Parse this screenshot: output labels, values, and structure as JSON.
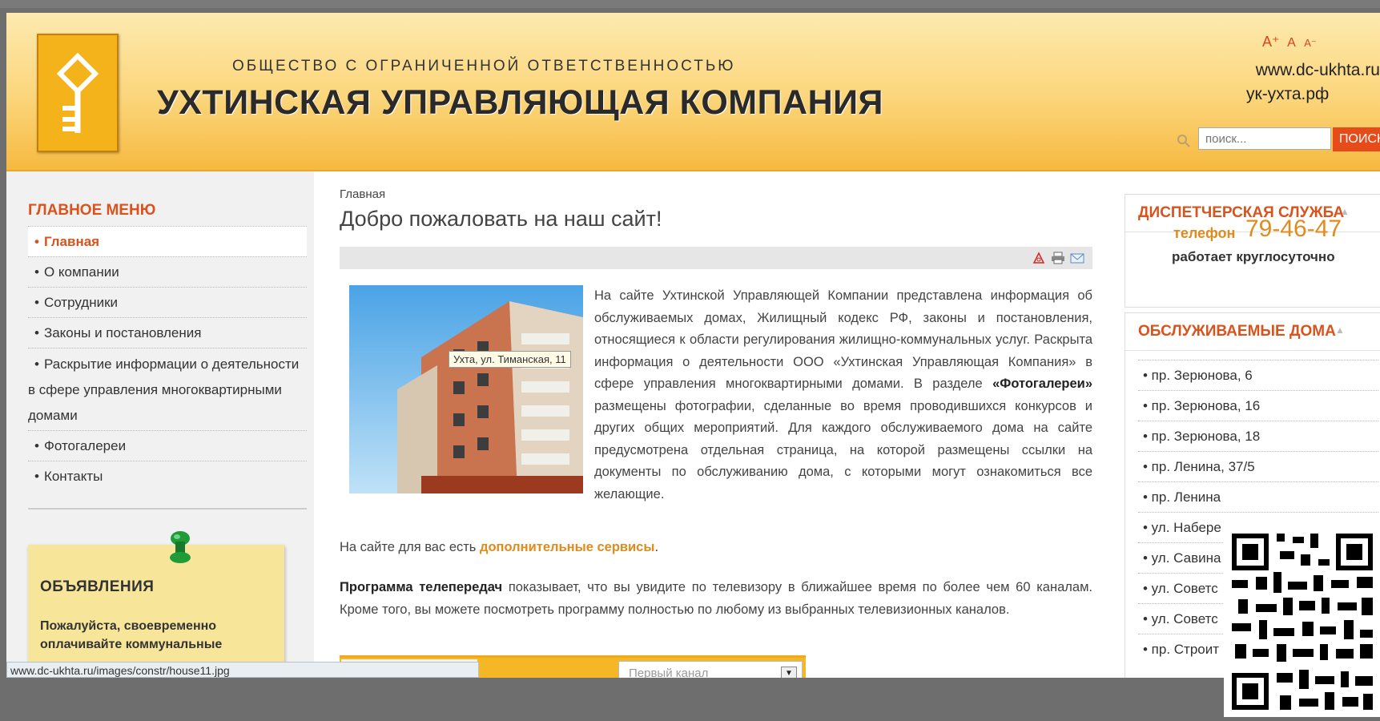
{
  "header": {
    "company_sub": "ОБЩЕСТВО С ОГРАНИЧЕННОЙ ОТВЕТСТВЕННОСТЬЮ",
    "company_name": "УХТИНСКАЯ УПРАВЛЯЮЩАЯ КОМПАНИЯ",
    "font_controls": [
      "A⁺",
      "A",
      "A⁻"
    ],
    "site_url": "www.dc-ukhta.ru",
    "site_url_rf": "ук-ухта.рф",
    "search_placeholder": "поиск...",
    "search_button": "ПОИСК"
  },
  "sidebar": {
    "menu_title": "ГЛАВНОЕ МЕНЮ",
    "items": [
      {
        "label": "Главная",
        "active": true
      },
      {
        "label": "О компании"
      },
      {
        "label": "Сотрудники"
      },
      {
        "label": "Законы и постановления"
      },
      {
        "label": "Раскрытие информации о деятельности в сфере управления многоквартирными домами"
      },
      {
        "label": "Фотогалереи"
      },
      {
        "label": "Контакты"
      }
    ],
    "notice_title": "ОБЪЯВЛЕНИЯ",
    "notice_text": "Пожалуйста, своевременно оплачивайте коммунальные"
  },
  "main": {
    "breadcrumb": "Главная",
    "title": "Добро пожаловать на наш сайт!",
    "photo_tooltip": "Ухта, ул. Тиманская, 11",
    "paragraph1_a": "На сайте Ухтинской Управляющей Компании представлена информация об обслуживаемых домах, Жилищный кодекс РФ, законы и постановления, относящиеся к области регулирования жилищно-коммунальных услуг. Раскрыта информация о деятельности ООО «Ухтинская Управляющая Компания» в сфере управления многоквартирными домами. В разделе ",
    "paragraph1_bold": "«Фотогалереи»",
    "paragraph1_b": " размещены фотографии, сделанные во время проводившихся конкурсов и других общих мероприятий. Для каждого обслуживаемого дома на сайте предусмотрена отдельная страница, на которой размещены ссылки на документы по обслуживанию дома, с которыми могут ознакомиться все желающие.",
    "paragraph2_a": "На сайте для вас есть ",
    "paragraph2_link": "дополнительные сервисы",
    "paragraph2_b": ".",
    "paragraph3_bold": "Программа телепередач",
    "paragraph3": " показывает, что вы увидите по телевизору в ближайшее время по более чем 60 каналам. Кроме того, вы можете посмотреть программу полностью по любому из выбранных телевизионных каналов.",
    "tv_channel": "Первый канал"
  },
  "right": {
    "dispatch_title": "ДИСПЕТЧЕРСКАЯ СЛУЖБА",
    "phone_label": "телефон",
    "phone_number": "79-46-47",
    "phone_note": "работает круглосуточно",
    "houses_title": "ОБСЛУЖИВАЕМЫЕ ДОМА",
    "houses": [
      "• пр. Зерюнова, 6",
      "• пр. Зерюнова, 16",
      "• пр. Зерюнова, 18",
      "• пр. Ленина, 37/5",
      "• пр. Ленина",
      "• ул. Набере",
      "• ул. Савина",
      "• ул. Советс",
      "• ул. Советс",
      "• пр. Строит"
    ]
  },
  "statusbar": {
    "url": "www.dc-ukhta.ru/images/constr/house11.jpg"
  },
  "colors": {
    "accent": "#d9531d",
    "orange": "#e08b1e",
    "header_yellow": "#fbd57a",
    "search_button": "#e64b1a"
  }
}
